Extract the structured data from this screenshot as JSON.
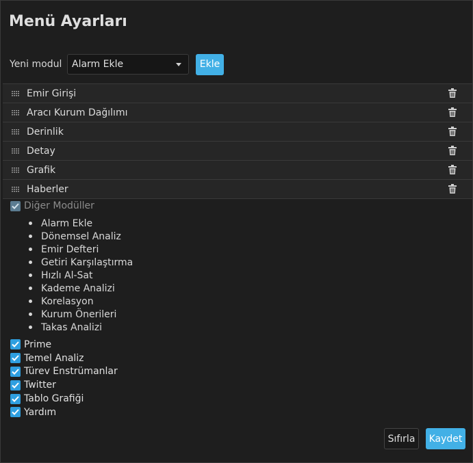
{
  "dialog": {
    "title": "Menü Ayarları",
    "new_module_label": "Yeni modul",
    "new_module_select": "Alarm Ekle",
    "add_button": "Ekle",
    "reset_button": "Sıfırla",
    "save_button": "Kaydet",
    "accent": "#42b0e6"
  },
  "modules": [
    {
      "label": "Emir Girişi"
    },
    {
      "label": "Aracı Kurum Dağılımı"
    },
    {
      "label": "Derinlik"
    },
    {
      "label": "Detay"
    },
    {
      "label": "Grafik"
    },
    {
      "label": "Haberler"
    }
  ],
  "other_modules": {
    "label": "Diğer Modüller",
    "checked": true,
    "disabled": true,
    "items": [
      "Alarm Ekle",
      "Dönemsel Analiz",
      "Emir Defteri",
      "Getiri Karşılaştırma",
      "Hızlı Al-Sat",
      "Kademe Analizi",
      "Korelasyon",
      "Kurum Önerileri",
      "Takas Analizi"
    ]
  },
  "extras": [
    {
      "label": "Prime",
      "checked": true
    },
    {
      "label": "Temel Analiz",
      "checked": true
    },
    {
      "label": "Türev Enstrümanlar",
      "checked": true
    },
    {
      "label": "Twitter",
      "checked": true
    },
    {
      "label": "Tablo Grafiği",
      "checked": true
    },
    {
      "label": "Yardım",
      "checked": true
    }
  ]
}
